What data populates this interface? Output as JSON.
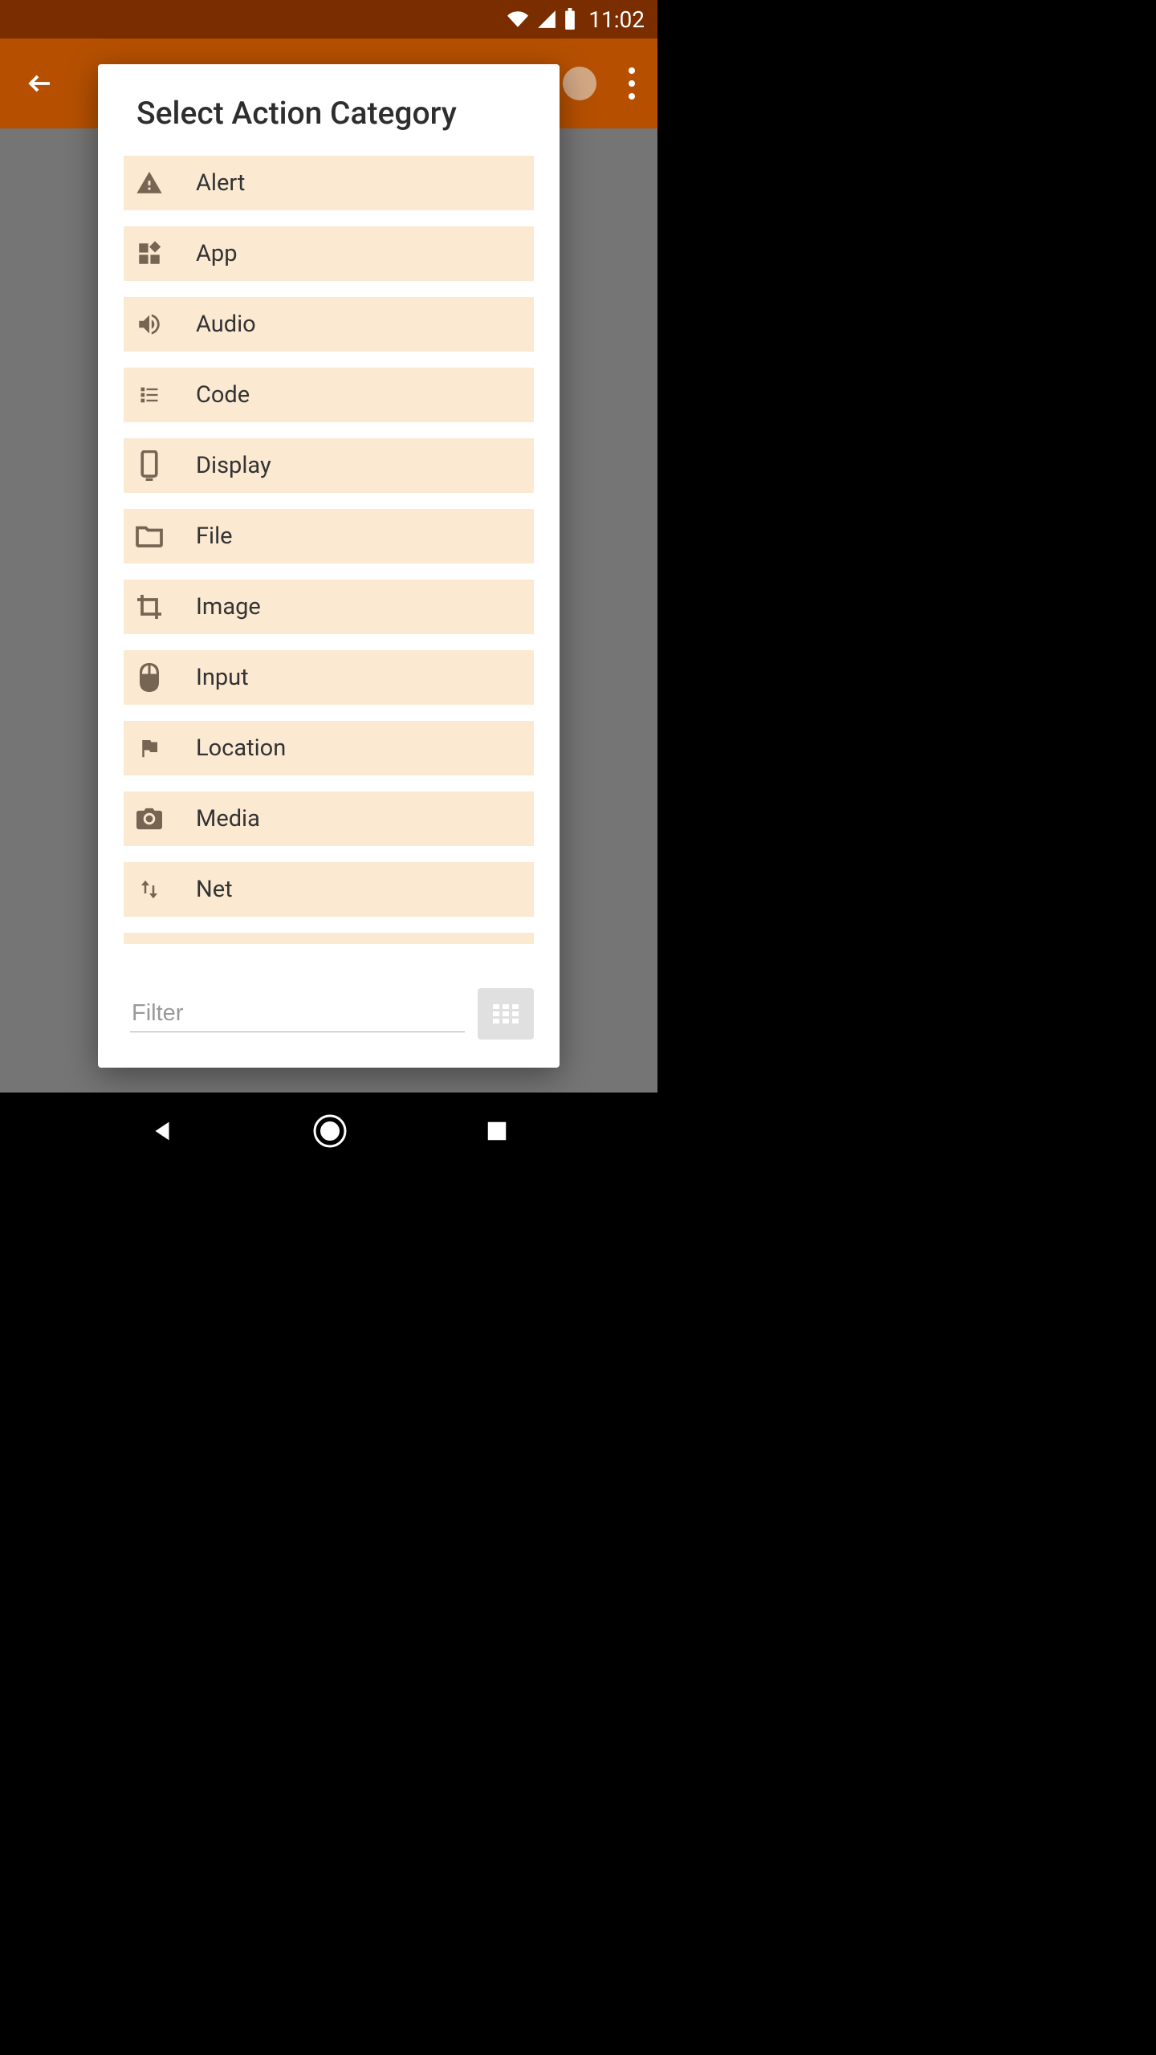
{
  "status_bar": {
    "time": "11:02"
  },
  "modal": {
    "title": "Select Action Category",
    "filter_placeholder": "Filter",
    "categories": [
      {
        "label": "Alert",
        "icon": "warning"
      },
      {
        "label": "App",
        "icon": "widgets"
      },
      {
        "label": "Audio",
        "icon": "volume"
      },
      {
        "label": "Code",
        "icon": "list"
      },
      {
        "label": "Display",
        "icon": "smartphone"
      },
      {
        "label": "File",
        "icon": "folder"
      },
      {
        "label": "Image",
        "icon": "crop"
      },
      {
        "label": "Input",
        "icon": "mouse"
      },
      {
        "label": "Location",
        "icon": "flag"
      },
      {
        "label": "Media",
        "icon": "camera"
      },
      {
        "label": "Net",
        "icon": "swap_vert"
      }
    ]
  }
}
